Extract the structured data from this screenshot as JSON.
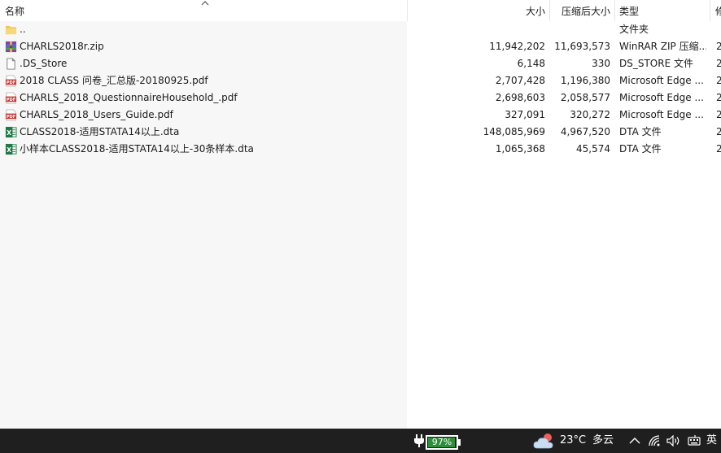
{
  "columns": {
    "name": "名称",
    "size": "大小",
    "compressed": "压缩后大小",
    "type": "类型",
    "extra": "修"
  },
  "files": [
    {
      "icon": "folder-icon",
      "name": "..",
      "size": "",
      "compressed": "",
      "type": "文件夹",
      "extra": ""
    },
    {
      "icon": "winrar-icon",
      "name": "CHARLS2018r.zip",
      "size": "11,942,202",
      "compressed": "11,693,573",
      "type": "WinRAR ZIP 压缩...",
      "extra": "2"
    },
    {
      "icon": "file-icon",
      "name": ".DS_Store",
      "size": "6,148",
      "compressed": "330",
      "type": "DS_STORE 文件",
      "extra": "2"
    },
    {
      "icon": "pdf-icon",
      "name": "2018 CLASS 问卷_汇总版-20180925.pdf",
      "size": "2,707,428",
      "compressed": "1,196,380",
      "type": "Microsoft Edge ...",
      "extra": "2"
    },
    {
      "icon": "pdf-icon",
      "name": "CHARLS_2018_QuestionnaireHousehold_.pdf",
      "size": "2,698,603",
      "compressed": "2,058,577",
      "type": "Microsoft Edge ...",
      "extra": "2"
    },
    {
      "icon": "pdf-icon",
      "name": "CHARLS_2018_Users_Guide.pdf",
      "size": "327,091",
      "compressed": "320,272",
      "type": "Microsoft Edge ...",
      "extra": "2"
    },
    {
      "icon": "excel-icon",
      "name": "CLASS2018-适用STATA14以上.dta",
      "size": "148,085,969",
      "compressed": "4,967,520",
      "type": "DTA 文件",
      "extra": "2"
    },
    {
      "icon": "excel-icon",
      "name": "小样本CLASS2018-适用STATA14以上-30条样本.dta",
      "size": "1,065,368",
      "compressed": "45,574",
      "type": "DTA 文件",
      "extra": "2"
    }
  ],
  "taskbar": {
    "battery_percent": "97%",
    "battery_level": 0.97,
    "temperature": "23°C",
    "weather": "多云",
    "ime": "英",
    "battery_color": "#2d8f3a"
  }
}
